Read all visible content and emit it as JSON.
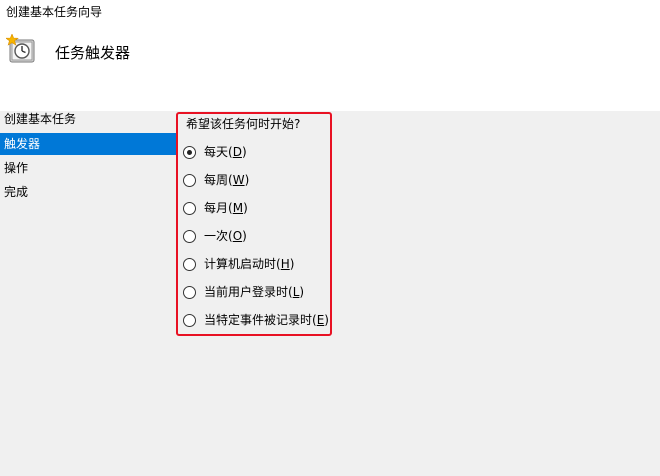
{
  "window": {
    "title": "创建基本任务向导"
  },
  "header": {
    "icon": "clock-star-icon",
    "title": "任务触发器"
  },
  "sidebar": {
    "items": [
      {
        "label": "创建基本任务",
        "active": false
      },
      {
        "label": "触发器",
        "active": true
      },
      {
        "label": "操作",
        "active": false
      },
      {
        "label": "完成",
        "active": false
      }
    ]
  },
  "trigger": {
    "question": "希望该任务何时开始?",
    "selected": "每天(D)",
    "options": [
      {
        "text": "每天",
        "key": "D",
        "checked": true
      },
      {
        "text": "每周",
        "key": "W",
        "checked": false
      },
      {
        "text": "每月",
        "key": "M",
        "checked": false
      },
      {
        "text": "一次",
        "key": "O",
        "checked": false
      },
      {
        "text": "计算机启动时",
        "key": "H",
        "checked": false
      },
      {
        "text": "当前用户登录时",
        "key": "L",
        "checked": false
      },
      {
        "text": "当特定事件被记录时",
        "key": "E",
        "checked": false
      }
    ]
  },
  "colors": {
    "accent": "#0078d7",
    "highlight_border": "#e81123"
  }
}
